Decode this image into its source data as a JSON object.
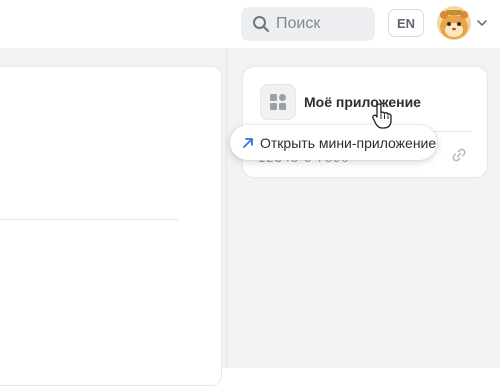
{
  "header": {
    "search_placeholder": "Поиск",
    "search_icon": "search-icon",
    "language": "EN",
    "avatar_icon": "avatar",
    "menu_chevron_icon": "chevron-down-icon"
  },
  "app_card": {
    "name": "Моё приложение",
    "app_id": "12345 6 7890",
    "icon": "grid-icon",
    "link_icon": "link-icon"
  },
  "tooltip": {
    "label": "Открыть мини-приложение",
    "icon": "arrow-up-right-icon"
  },
  "colors": {
    "accent": "#2a7ae2",
    "page_bg": "#f1f2f4",
    "card_bg": "#ffffff"
  }
}
